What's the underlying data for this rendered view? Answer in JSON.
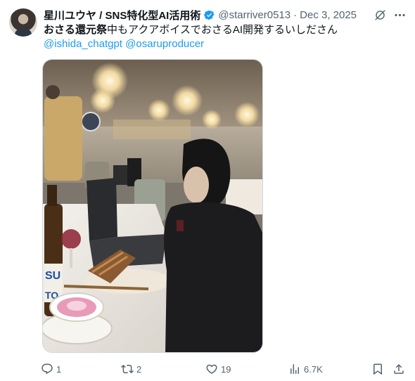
{
  "author": {
    "display_name": "星川ユウヤ / SNS特化型AI活用術",
    "handle": "@starriver0513",
    "separator": "·",
    "date": "Dec 3, 2025"
  },
  "tweet": {
    "text_bold": "おさる還元祭",
    "text_rest": "中もアクアボイスでおさるAI開発するいしださん",
    "mentions": [
      "@ishida_chatgpt",
      "@osaruproducer"
    ],
    "photo_label_1": "SU",
    "photo_label_2": "TO"
  },
  "actions": {
    "replies": "1",
    "reposts": "2",
    "likes": "19",
    "views": "6.7K"
  },
  "colors": {
    "accent": "#1d9bf0",
    "secondary_text": "#536471",
    "primary_text": "#0f1419"
  },
  "icons": [
    "verified-badge-icon",
    "grok-icon",
    "more-icon",
    "reply-icon",
    "retweet-icon",
    "like-icon",
    "views-icon",
    "bookmark-icon",
    "share-icon"
  ]
}
